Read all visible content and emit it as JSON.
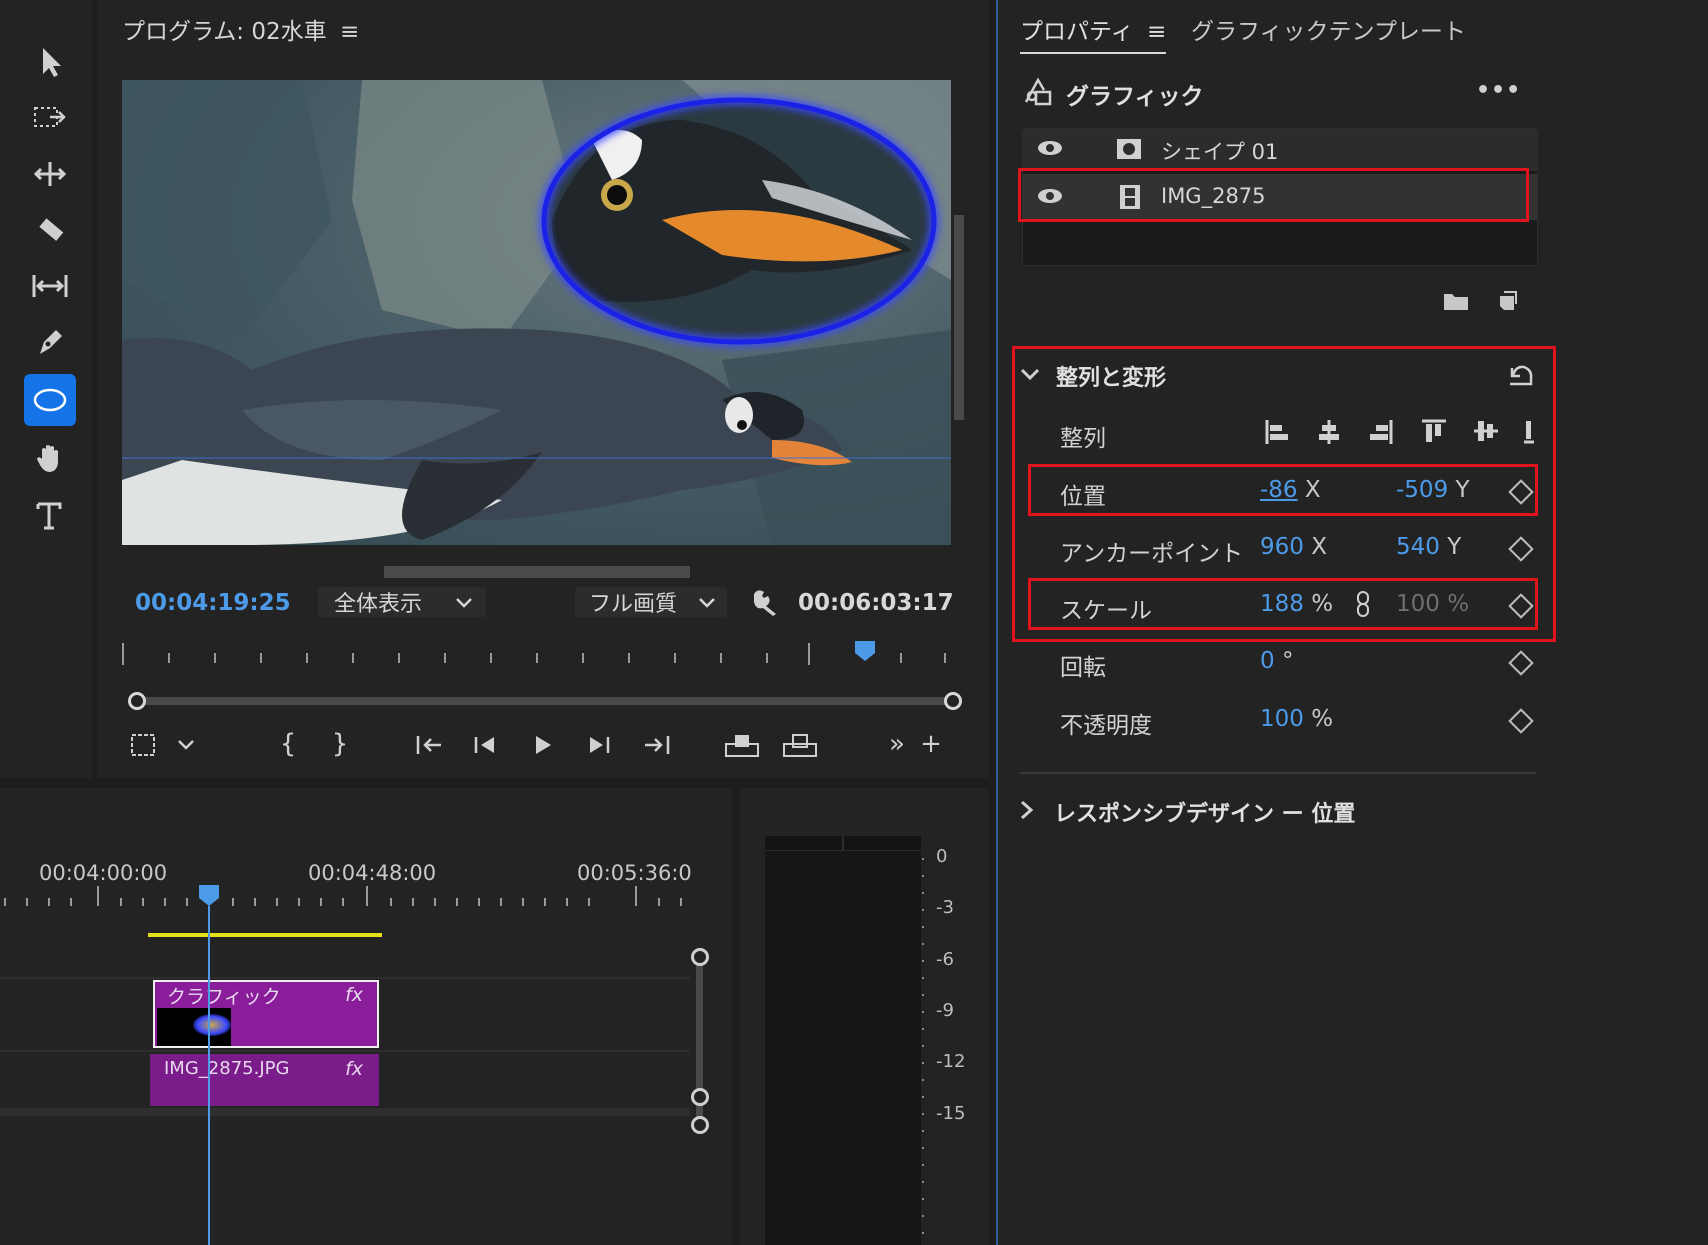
{
  "program": {
    "title": "プログラム: 02水車",
    "current_time": "00:04:19:25",
    "zoom": "全体表示",
    "quality": "フル画質",
    "duration": "00:06:03:17"
  },
  "properties": {
    "tab_properties": "プロパティ",
    "tab_templates": "グラフィックテンプレート",
    "section_title": "グラフィック",
    "layers": [
      {
        "name": "シェイプ 01"
      },
      {
        "name": "IMG_2875"
      }
    ],
    "align_transform": {
      "title": "整列と変形",
      "align_label": "整列",
      "position": {
        "label": "位置",
        "x": "-86",
        "x_unit": "X",
        "y": "-509",
        "y_unit": "Y"
      },
      "anchor": {
        "label": "アンカーポイント",
        "x": "960",
        "x_unit": "X",
        "y": "540",
        "y_unit": "Y"
      },
      "scale": {
        "label": "スケール",
        "value": "188",
        "unit": "%",
        "linked_value": "100 %"
      },
      "rotation": {
        "label": "回転",
        "value": "0",
        "unit": "°"
      },
      "opacity": {
        "label": "不透明度",
        "value": "100",
        "unit": "%"
      }
    },
    "responsive": {
      "title": "レスポンシブデザイン ー 位置"
    }
  },
  "timeline": {
    "times": [
      "00:04:00:00",
      "00:04:48:00",
      "00:05:36:0"
    ],
    "clips": [
      {
        "name": "クラフィック",
        "fx": "fx"
      },
      {
        "name": "IMG_2875.JPG",
        "fx": "fx"
      }
    ]
  },
  "meter": {
    "labels": [
      "0",
      "-3",
      "-6",
      "-9",
      "-12",
      "-15"
    ]
  },
  "colors": {
    "accent": "#4d9ae8",
    "highlight": "#e0141c",
    "clip": "#8a1e9a",
    "ellipse": "#1a22e6"
  }
}
